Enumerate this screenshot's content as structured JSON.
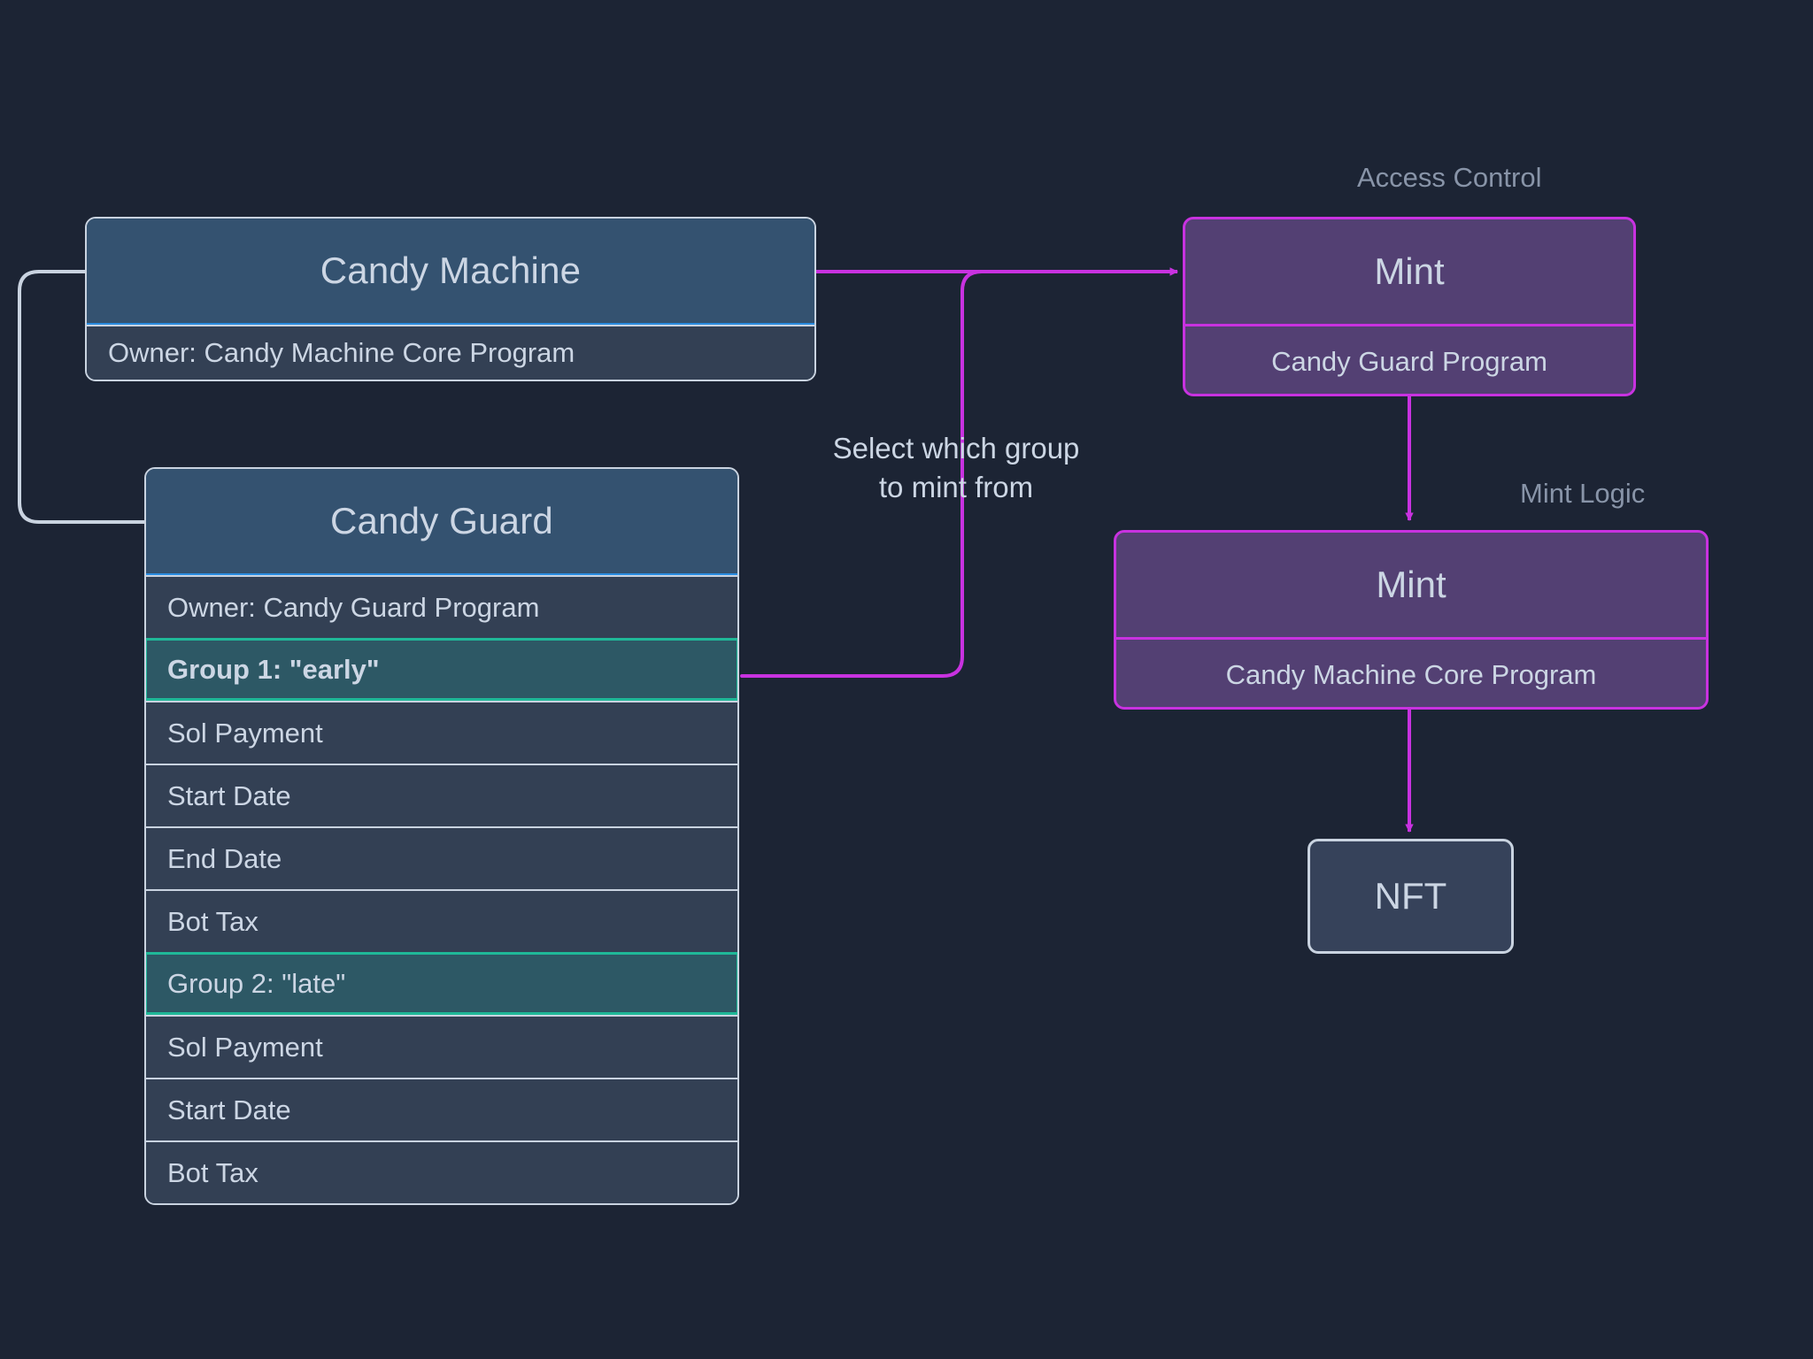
{
  "colors": {
    "background": "#1c2434",
    "accent_blue": "#2a8ce0",
    "accent_magenta": "#c832e0",
    "accent_teal": "#1fb898",
    "node_blue_fill": "#345270",
    "node_purple_fill": "#534073",
    "row_fill": "#334054",
    "group_row_fill": "#2d5865",
    "text": "#ccd6e4",
    "muted_text": "#8894a8",
    "connector_grey": "#c9d3e0"
  },
  "nodes": {
    "candy_machine": {
      "title": "Candy Machine",
      "rows": [
        "Owner: Candy Machine Core Program"
      ]
    },
    "candy_guard": {
      "title": "Candy Guard",
      "rows": [
        {
          "label": "Owner: Candy Guard Program",
          "group": false,
          "bold": false
        },
        {
          "label": "Group 1: \"early\"",
          "group": true,
          "bold": true
        },
        {
          "label": "Sol Payment",
          "group": false,
          "bold": false
        },
        {
          "label": "Start Date",
          "group": false,
          "bold": false
        },
        {
          "label": "End Date",
          "group": false,
          "bold": false
        },
        {
          "label": "Bot Tax",
          "group": false,
          "bold": false
        },
        {
          "label": "Group 2: \"late\"",
          "group": true,
          "bold": false
        },
        {
          "label": "Sol Payment",
          "group": false,
          "bold": false
        },
        {
          "label": "Start Date",
          "group": false,
          "bold": false
        },
        {
          "label": "Bot Tax",
          "group": false,
          "bold": false
        }
      ]
    },
    "mint_guard": {
      "title": "Mint",
      "subtitle": "Candy Guard Program",
      "caption": "Access Control"
    },
    "mint_core": {
      "title": "Mint",
      "subtitle": "Candy Machine Core Program",
      "caption": "Mint Logic"
    },
    "nft": {
      "title": "NFT"
    }
  },
  "annotations": {
    "select_group": "Select which group\nto mint from"
  }
}
